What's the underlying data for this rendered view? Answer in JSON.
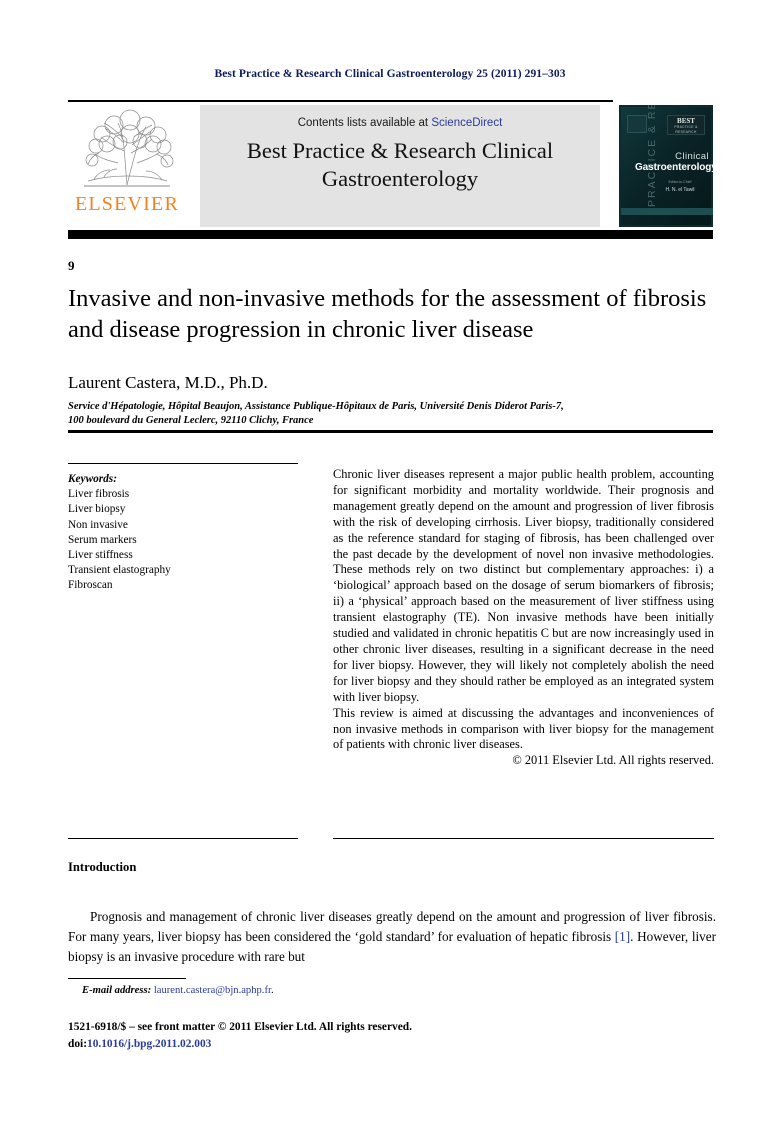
{
  "running_head": "Best Practice & Research Clinical Gastroenterology 25 (2011) 291–303",
  "masthead": {
    "contents_prefix": "Contents lists available at ",
    "sciencedirect": "ScienceDirect",
    "journal_title": "Best Practice & Research Clinical Gastroenterology",
    "publisher_logo_text": "ELSEVIER",
    "publisher_color": "#f58220",
    "link_color": "#2b3a9c",
    "band_color": "#e3e3e3"
  },
  "cover": {
    "vertical_text": "PRACTICE & RESEARCH",
    "badge_line1": "BEST",
    "badge_line2": "PRACTICE & RESEARCH",
    "title_line1": "Clinical",
    "title_line2": "Gastroenterology",
    "editor_label": "Editor-in-Chief",
    "editor_name": "H. N. el Tawil",
    "background_color": "#0d2b2e"
  },
  "article": {
    "chapter_number": "9",
    "title": "Invasive and non-invasive methods for the assessment of fibrosis and disease progression in chronic liver disease",
    "author": "Laurent Castera, M.D., Ph.D.",
    "affiliation_line1": "Service d'Hépatologie, Hôpital Beaujon, Assistance Publique-Hôpitaux de Paris, Université Denis Diderot Paris-7,",
    "affiliation_line2": "100 boulevard du General Leclerc, 92110 Clichy, France"
  },
  "keywords": {
    "heading": "Keywords:",
    "items": [
      "Liver fibrosis",
      "Liver biopsy",
      "Non invasive",
      "Serum markers",
      "Liver stiffness",
      "Transient elastography",
      "Fibroscan"
    ]
  },
  "abstract": {
    "paragraph1": "Chronic liver diseases represent a major public health problem, accounting for significant morbidity and mortality worldwide. Their prognosis and management greatly depend on the amount and progression of liver fibrosis with the risk of developing cirrhosis. Liver biopsy, traditionally considered as the reference standard for staging of fibrosis, has been challenged over the past decade by the development of novel non invasive methodologies. These methods rely on two distinct but complementary approaches: i) a ‘biological’ approach based on the dosage of serum biomarkers of fibrosis; ii) a ‘physical’ approach based on the measurement of liver stiffness using transient elastography (TE). Non invasive methods have been initially studied and validated in chronic hepatitis C but are now increasingly used in other chronic liver diseases, resulting in a significant decrease in the need for liver biopsy. However, they will likely not completely abolish the need for liver biopsy and they should rather be employed as an integrated system with liver biopsy.",
    "paragraph2": "This review is aimed at discussing the advantages and inconveniences of non invasive methods in comparison with liver biopsy for the management of patients with chronic liver diseases.",
    "copyright": "© 2011 Elsevier Ltd. All rights reserved."
  },
  "body": {
    "section_heading": "Introduction",
    "paragraph_part1": "Prognosis and management of chronic liver diseases greatly depend on the amount and progression of liver fibrosis. For many years, liver biopsy has been considered the ‘gold standard’ for evaluation of hepatic fibrosis ",
    "citation": "[1]",
    "paragraph_part2": ". However, liver biopsy is an invasive procedure with rare but"
  },
  "footer": {
    "email_label": "E-mail address:",
    "email": "laurent.castera@bjn.aphp.fr",
    "email_suffix": ".",
    "imprint_line": "1521-6918/$ – see front matter © 2011 Elsevier Ltd. All rights reserved.",
    "doi_label": "doi:",
    "doi_value": "10.1016/j.bpg.2011.02.003"
  }
}
